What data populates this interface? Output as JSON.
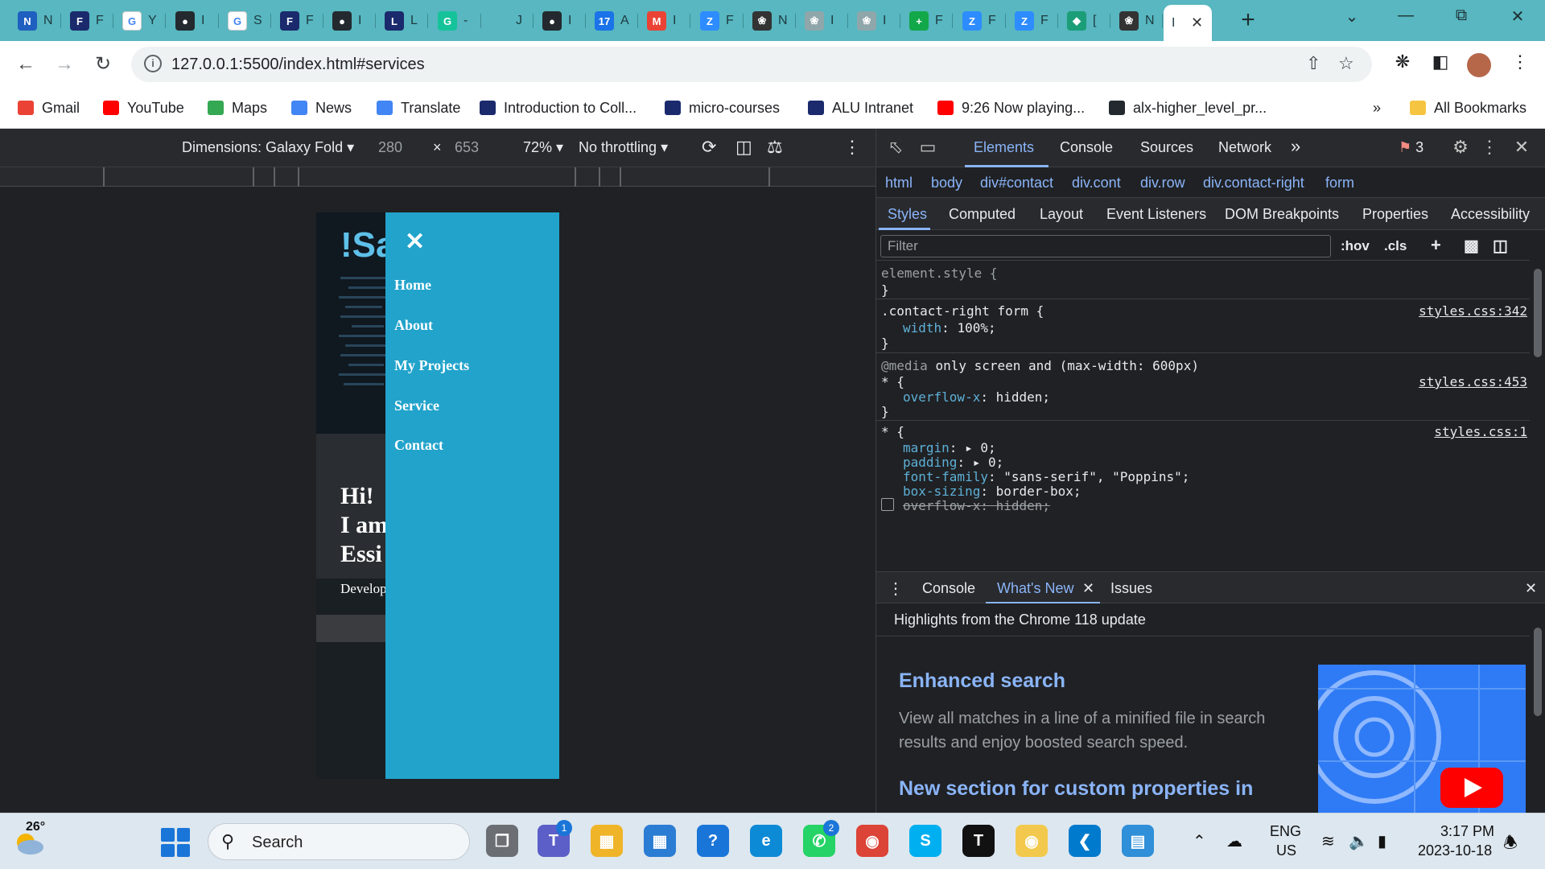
{
  "browser": {
    "tabs": [
      {
        "icon": "tab-icon-site",
        "letter": "N",
        "color": "#1f5fbf",
        "title": "N"
      },
      {
        "icon": "tab-icon-alu",
        "letter": "F",
        "color": "#1a2a6c",
        "title": "F"
      },
      {
        "icon": "tab-icon-google",
        "letter": "G",
        "color": "#ffffff",
        "title": "Y"
      },
      {
        "icon": "tab-icon-github",
        "letter": "●",
        "color": "#24292f",
        "title": "I"
      },
      {
        "icon": "tab-icon-google",
        "letter": "G",
        "color": "#ffffff",
        "title": "S"
      },
      {
        "icon": "tab-icon-alu",
        "letter": "F",
        "color": "#1a2a6c",
        "title": "F"
      },
      {
        "icon": "tab-icon-github",
        "letter": "●",
        "color": "#24292f",
        "title": "I"
      },
      {
        "icon": "tab-icon-alu",
        "letter": "L",
        "color": "#1a2a6c",
        "title": "L"
      },
      {
        "icon": "tab-icon-grammarly",
        "letter": "G",
        "color": "#15c39a",
        "title": "-"
      },
      {
        "icon": "tab-icon-blank",
        "letter": "",
        "color": "#58b7c0",
        "title": "J"
      },
      {
        "icon": "tab-icon-github",
        "letter": "●",
        "color": "#24292f",
        "title": "I"
      },
      {
        "icon": "tab-icon-calendar",
        "letter": "17",
        "color": "#1a73e8",
        "title": "A"
      },
      {
        "icon": "tab-icon-gmail",
        "letter": "M",
        "color": "#ea4335",
        "title": "I"
      },
      {
        "icon": "tab-icon-zoom",
        "letter": "Z",
        "color": "#2d8cff",
        "title": "F"
      },
      {
        "icon": "tab-icon-openai",
        "letter": "❀",
        "color": "#333333",
        "title": "N"
      },
      {
        "icon": "tab-icon-openai",
        "letter": "❀",
        "color": "#8fa7aa",
        "title": "I"
      },
      {
        "icon": "tab-icon-openai",
        "letter": "❀",
        "color": "#8fa7aa",
        "title": "I"
      },
      {
        "icon": "tab-icon-plus",
        "letter": "+",
        "color": "#12a84a",
        "title": "F"
      },
      {
        "icon": "tab-icon-zoom",
        "letter": "Z",
        "color": "#2d8cff",
        "title": "F"
      },
      {
        "icon": "tab-icon-zoom",
        "letter": "Z",
        "color": "#2d8cff",
        "title": "F"
      },
      {
        "icon": "tab-icon-diamond",
        "letter": "◆",
        "color": "#1b9e77",
        "title": "["
      },
      {
        "icon": "tab-icon-openai",
        "letter": "❀",
        "color": "#333333",
        "title": "N"
      },
      {
        "icon": "tab-icon-blank",
        "letter": "",
        "color": "#ffffff",
        "title": "I",
        "active": true
      }
    ],
    "url": "127.0.0.1:5500/index.html#services",
    "bookmarks": [
      {
        "label": "Gmail",
        "color": "#ea4335"
      },
      {
        "label": "YouTube",
        "color": "#ff0000"
      },
      {
        "label": "Maps",
        "color": "#34a853"
      },
      {
        "label": "News",
        "color": "#4285f4"
      },
      {
        "label": "Translate",
        "color": "#4285f4"
      },
      {
        "label": "Introduction to Coll...",
        "color": "#1a2a6c"
      },
      {
        "label": "micro-courses",
        "color": "#1a2a6c"
      },
      {
        "label": "ALU Intranet",
        "color": "#1a2a6c"
      },
      {
        "label": "9:26 Now playing...",
        "color": "#ff0000"
      },
      {
        "label": "alx-higher_level_pr...",
        "color": "#24292f"
      }
    ],
    "bookmarks_overflow": "»",
    "all_bookmarks": "All Bookmarks"
  },
  "device_toolbar": {
    "dimensions_label": "Dimensions: Galaxy Fold",
    "width": "280",
    "times": "×",
    "height": "653",
    "zoom": "72%",
    "throttling": "No throttling"
  },
  "emulated_page": {
    "brand": "!Sa",
    "hero_lines": [
      "Hi!",
      "I am",
      "Essi"
    ],
    "tagline": "Develop",
    "menu_close": "✕",
    "menu_items": [
      "Home",
      "About",
      "My Projects",
      "Service",
      "Contact"
    ]
  },
  "devtools": {
    "tabs": [
      "Elements",
      "Console",
      "Sources",
      "Network"
    ],
    "more_tabs": "»",
    "error_count": "3",
    "breadcrumb": [
      "html",
      "body",
      "div#contact",
      "div.cont",
      "div.row",
      "div.contact-right",
      "form"
    ],
    "subtabs": [
      "Styles",
      "Computed",
      "Layout",
      "Event Listeners",
      "DOM Breakpoints",
      "Properties",
      "Accessibility"
    ],
    "filter_placeholder": "Filter",
    "hov": ":hov",
    "cls": ".cls",
    "rules": {
      "element_style_open": "element.style {",
      "close": "}",
      "r1_selector": ".contact-right form {",
      "r1_source": "styles.css:342",
      "r1_prop": "width",
      "r1_val": "100%;",
      "r2_media": "@media",
      "r2_media_rest": "only screen and (max-width: 600px)",
      "r2_selector": "* {",
      "r2_source": "styles.css:453",
      "r2_prop": "overflow-x",
      "r2_val": "hidden;",
      "r3_selector": "* {",
      "r3_source": "styles.css:1",
      "r3_margin": "margin",
      "r3_margin_val": "0;",
      "r3_padding": "padding",
      "r3_padding_val": "0;",
      "r3_font": "font-family",
      "r3_font_val": "\"sans-serif\", \"Poppins\";",
      "r3_box": "box-sizing",
      "r3_box_val": "border-box;",
      "r3_overflow": "overflow-x",
      "r3_overflow_val": "hidden;"
    },
    "drawer": {
      "tabs": [
        "Console",
        "What's New",
        "Issues"
      ],
      "highlights": "Highlights from the Chrome 118 update",
      "title": "Enhanced search",
      "body": "View all matches in a line of a minified file in search results and enjoy boosted search speed.",
      "title2": "New section for custom properties in"
    }
  },
  "taskbar": {
    "temperature": "26°",
    "search_label": "Search",
    "language": "ENG",
    "region": "US",
    "time": "3:17 PM",
    "date": "2023-10-18",
    "teams_badge": "1",
    "whatsapp_badge": "2"
  }
}
